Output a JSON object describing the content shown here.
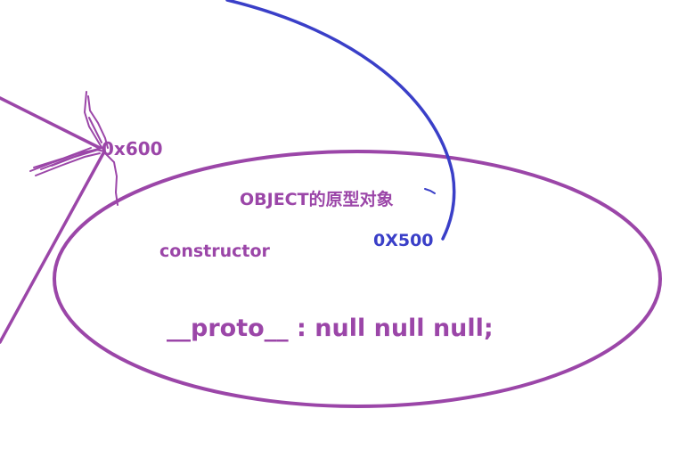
{
  "colors": {
    "purple": "#9b46a8",
    "blue": "#3a3fc8",
    "background": "#ffffff"
  },
  "labels": {
    "address_600": "0x600",
    "prototype_title": "OBJECT的原型对象",
    "address_500": "0X500",
    "constructor": "constructor",
    "proto": "__proto__ : null null null;"
  }
}
